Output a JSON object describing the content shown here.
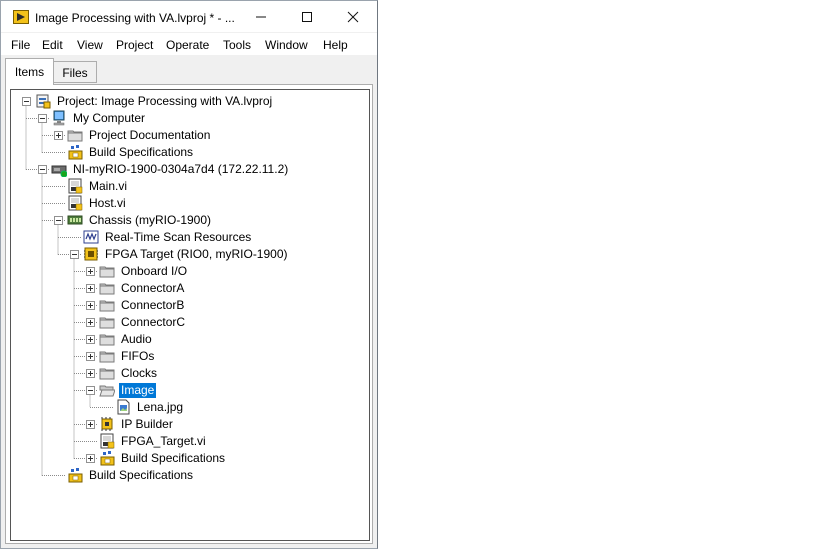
{
  "window": {
    "title": "Image Processing with VA.lvproj * - ...",
    "controls": [
      "minimize",
      "maximize",
      "close"
    ]
  },
  "menu": [
    "File",
    "Edit",
    "View",
    "Project",
    "Operate",
    "Tools",
    "Window",
    "Help"
  ],
  "tabs": [
    {
      "label": "Items",
      "active": true
    },
    {
      "label": "Files",
      "active": false
    }
  ],
  "tree": [
    {
      "label": "Project: Image Processing with VA.lvproj",
      "icon": "project-icon",
      "expander": "minus"
    },
    {
      "label": "My Computer",
      "icon": "computer-icon",
      "expander": "minus"
    },
    {
      "label": "Project Documentation",
      "icon": "folder-icon",
      "expander": "plus"
    },
    {
      "label": "Build Specifications",
      "icon": "build-spec-icon",
      "expander": "none"
    },
    {
      "label": "NI-myRIO-1900-0304a7d4 (172.22.11.2)",
      "icon": "myrio-target-icon",
      "expander": "minus"
    },
    {
      "label": "Main.vi",
      "icon": "vi-icon",
      "expander": "none"
    },
    {
      "label": "Host.vi",
      "icon": "vi-icon",
      "expander": "none"
    },
    {
      "label": "Chassis (myRIO-1900)",
      "icon": "chassis-icon",
      "expander": "minus"
    },
    {
      "label": "Real-Time Scan Resources",
      "icon": "scan-resources-icon",
      "expander": "none"
    },
    {
      "label": "FPGA Target (RIO0, myRIO-1900)",
      "icon": "fpga-target-icon",
      "expander": "minus"
    },
    {
      "label": "Onboard I/O",
      "icon": "folder-icon",
      "expander": "plus"
    },
    {
      "label": "ConnectorA",
      "icon": "folder-icon",
      "expander": "plus"
    },
    {
      "label": "ConnectorB",
      "icon": "folder-icon",
      "expander": "plus"
    },
    {
      "label": "ConnectorC",
      "icon": "folder-icon",
      "expander": "plus"
    },
    {
      "label": "Audio",
      "icon": "folder-icon",
      "expander": "plus"
    },
    {
      "label": "FIFOs",
      "icon": "folder-icon",
      "expander": "plus"
    },
    {
      "label": "Clocks",
      "icon": "folder-icon",
      "expander": "plus"
    },
    {
      "label": "Image",
      "icon": "folder-open-icon",
      "expander": "minus",
      "selected": true
    },
    {
      "label": "Lena.jpg",
      "icon": "image-file-icon",
      "expander": "none"
    },
    {
      "label": "IP Builder",
      "icon": "ip-builder-icon",
      "expander": "plus"
    },
    {
      "label": "FPGA_Target.vi",
      "icon": "vi-icon",
      "expander": "none"
    },
    {
      "label": "Build Specifications",
      "icon": "build-spec-icon",
      "expander": "plus"
    },
    {
      "label": "Build Specifications",
      "icon": "build-spec-icon",
      "expander": "none"
    }
  ]
}
